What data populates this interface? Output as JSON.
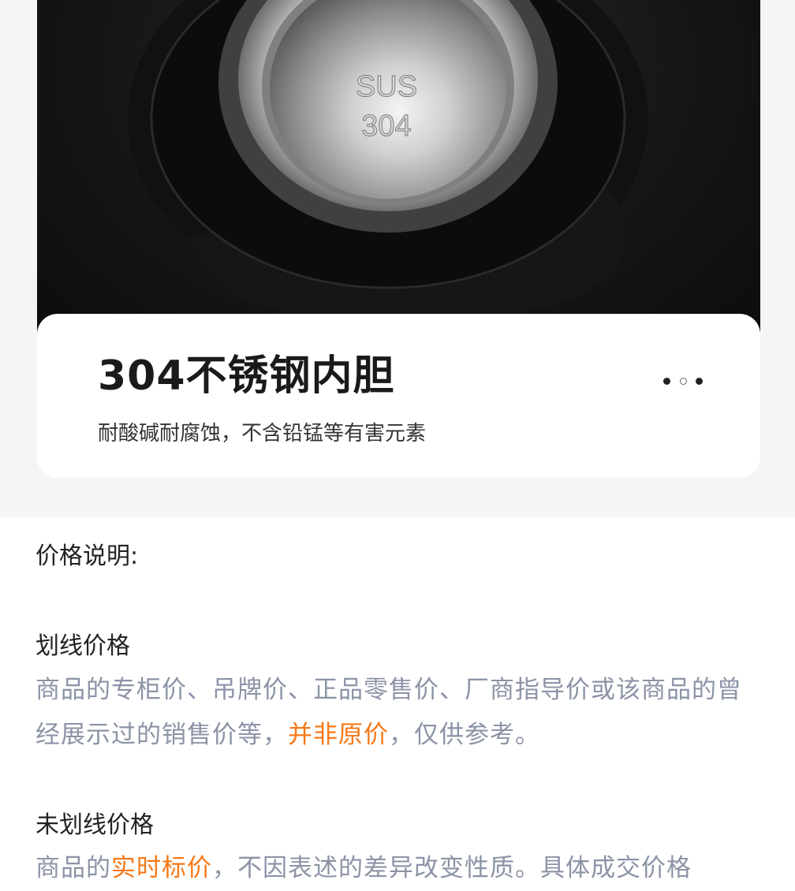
{
  "product_image": {
    "description_icon": "sus-304-steel-lid",
    "stamp_line1": "SUS",
    "stamp_line2": "304"
  },
  "feature_card": {
    "title": "304不锈钢内胆",
    "subtitle": "耐酸碱耐腐蚀，不含铅锰等有害元素",
    "pager": {
      "count": 3,
      "active_index": 1
    }
  },
  "price_info": {
    "heading": "价格说明:",
    "strikethrough": {
      "title": "划线价格",
      "text_before": "商品的专柜价、吊牌价、正品零售价、厂商指导价或该商品的曾经展示过的销售价等，",
      "highlight": "并非原价",
      "text_after": "，仅供参考。"
    },
    "non_strikethrough": {
      "title": "未划线价格",
      "text_before": "商品的",
      "highlight": "实时标价",
      "text_after": "，不因表述的差异改变性质。具体成交价格"
    }
  },
  "colors": {
    "highlight": "#f77817",
    "body_text": "#8b93a6",
    "title_text": "#1a1a1a"
  }
}
